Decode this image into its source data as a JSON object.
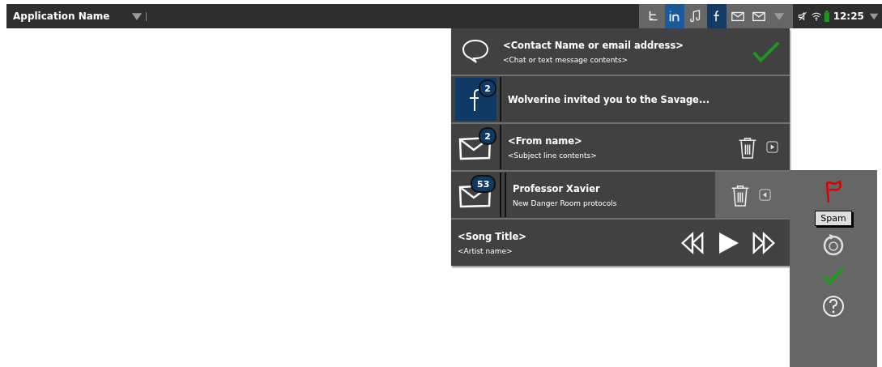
{
  "top_bar": {
    "app_name": "Application Name",
    "time": "12:25"
  },
  "tray_items": [
    {
      "kind": "twitter",
      "selected": false
    },
    {
      "kind": "linkedin",
      "selected": true
    },
    {
      "kind": "music",
      "selected": false
    },
    {
      "kind": "facebook",
      "selected": true
    },
    {
      "kind": "mail",
      "selected": false
    },
    {
      "kind": "mail",
      "selected": false
    }
  ],
  "notifications": [
    {
      "kind": "chat",
      "title": "<Contact Name or email address>",
      "subtitle": "<Chat or text message contents>",
      "acknowledged": true
    },
    {
      "kind": "facebook",
      "badge": "2",
      "title": "Wolverine invited you to the Savage..."
    },
    {
      "kind": "email",
      "badge": "2",
      "title": "<From name>",
      "subtitle": "<Subject line contents>",
      "swiped": false
    },
    {
      "kind": "email",
      "badge": "53",
      "title": "Professor Xavier",
      "subtitle": "New Danger Room protocols",
      "swiped": true
    }
  ],
  "media_player": {
    "title": "<Song Title>",
    "subtitle": "<Artist name>"
  },
  "side_actions": [
    {
      "kind": "flag"
    },
    {
      "kind": "snooze"
    },
    {
      "kind": "check"
    },
    {
      "kind": "help"
    }
  ],
  "tooltip": "Spam"
}
